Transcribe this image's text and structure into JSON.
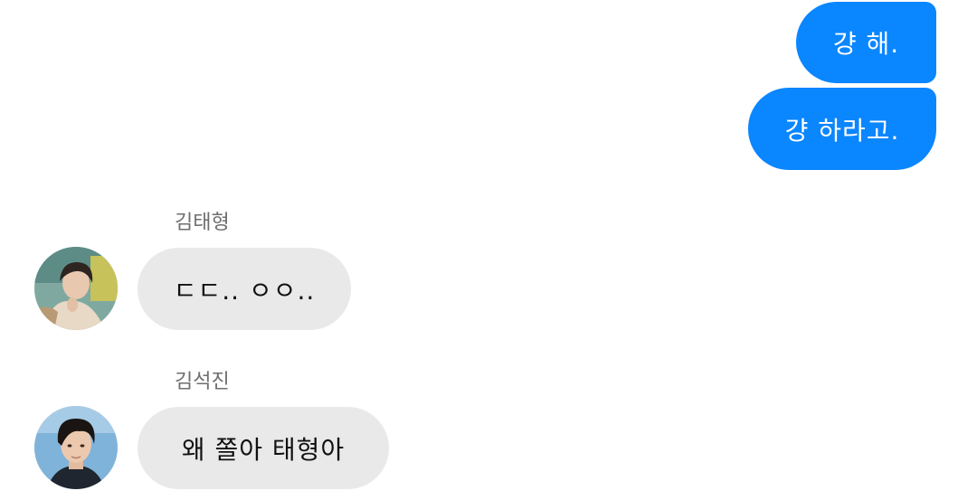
{
  "messages": {
    "outgoing": [
      {
        "text": "걍 해."
      },
      {
        "text": "걍 하라고."
      }
    ],
    "incoming": [
      {
        "sender": "김태형",
        "text": "ㄷㄷ.. ㅇㅇ..",
        "avatar_icon": "profile-photo-icon"
      },
      {
        "sender": "김석진",
        "text": "왜 쫄아 태형아",
        "avatar_icon": "profile-photo-icon"
      }
    ]
  },
  "colors": {
    "outgoing_bubble": "#0a86ff",
    "incoming_bubble": "#e9e9e9",
    "sender_name": "#6e6e6e",
    "background": "#ffffff"
  }
}
